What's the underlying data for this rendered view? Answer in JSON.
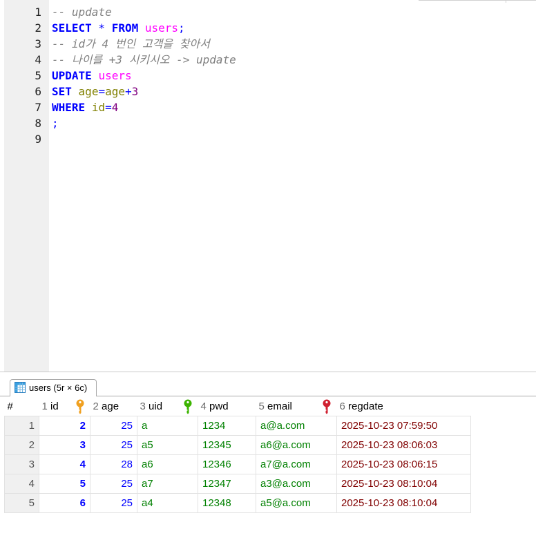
{
  "editor": {
    "line_numbers": [
      "1",
      "2",
      "3",
      "4",
      "5",
      "6",
      "7",
      "8",
      "9"
    ],
    "lines": [
      [
        {
          "t": "-- update",
          "c": "cm"
        }
      ],
      [
        {
          "t": "SELECT",
          "c": "kw"
        },
        {
          "t": " * ",
          "c": "op"
        },
        {
          "t": "FROM",
          "c": "kw"
        },
        {
          "t": " ",
          "c": ""
        },
        {
          "t": "users",
          "c": "tbl"
        },
        {
          "t": ";",
          "c": "op"
        }
      ],
      [
        {
          "t": "-- id가 4 번인 고객을 찾아서",
          "c": "cm"
        }
      ],
      [
        {
          "t": "-- 나이를 +3 시키시오 -> update",
          "c": "cm"
        }
      ],
      [
        {
          "t": "UPDATE",
          "c": "kw"
        },
        {
          "t": " ",
          "c": ""
        },
        {
          "t": "users",
          "c": "tbl"
        }
      ],
      [
        {
          "t": "SET",
          "c": "kw"
        },
        {
          "t": " ",
          "c": ""
        },
        {
          "t": "age",
          "c": "col"
        },
        {
          "t": "=",
          "c": "op"
        },
        {
          "t": "age",
          "c": "col"
        },
        {
          "t": "+",
          "c": "op"
        },
        {
          "t": "3",
          "c": "num"
        }
      ],
      [
        {
          "t": "WHERE",
          "c": "kw"
        },
        {
          "t": " ",
          "c": ""
        },
        {
          "t": "id",
          "c": "col"
        },
        {
          "t": "=",
          "c": "op"
        },
        {
          "t": "4",
          "c": "num"
        }
      ],
      [
        {
          "t": ";",
          "c": "op"
        }
      ],
      []
    ]
  },
  "result_tab": {
    "label": "users (5r × 6c)",
    "icon": "table-icon"
  },
  "grid": {
    "rownum_header": "#",
    "columns": [
      {
        "index": "1",
        "name": "id",
        "key": "primary-key-icon",
        "key_color": "#f0a020"
      },
      {
        "index": "2",
        "name": "age"
      },
      {
        "index": "3",
        "name": "uid",
        "key": "unique-key-icon",
        "key_color": "#3cb400"
      },
      {
        "index": "4",
        "name": "pwd"
      },
      {
        "index": "5",
        "name": "email",
        "key": "unique-key-icon",
        "key_color": "#d02030"
      },
      {
        "index": "6",
        "name": "regdate"
      }
    ],
    "rows": [
      {
        "n": "1",
        "id": "2",
        "age": "25",
        "uid": "a",
        "pwd": "1234",
        "email": "a@a.com",
        "regdate": "2025-10-23 07:59:50"
      },
      {
        "n": "2",
        "id": "3",
        "age": "25",
        "uid": "a5",
        "pwd": "12345",
        "email": "a6@a.com",
        "regdate": "2025-10-23 08:06:03"
      },
      {
        "n": "3",
        "id": "4",
        "age": "28",
        "uid": "a6",
        "pwd": "12346",
        "email": "a7@a.com",
        "regdate": "2025-10-23 08:06:15"
      },
      {
        "n": "4",
        "id": "5",
        "age": "25",
        "uid": "a7",
        "pwd": "12347",
        "email": "a3@a.com",
        "regdate": "2025-10-23 08:10:04"
      },
      {
        "n": "5",
        "id": "6",
        "age": "25",
        "uid": "a4",
        "pwd": "12348",
        "email": "a5@a.com",
        "regdate": "2025-10-23 08:10:04"
      }
    ]
  }
}
